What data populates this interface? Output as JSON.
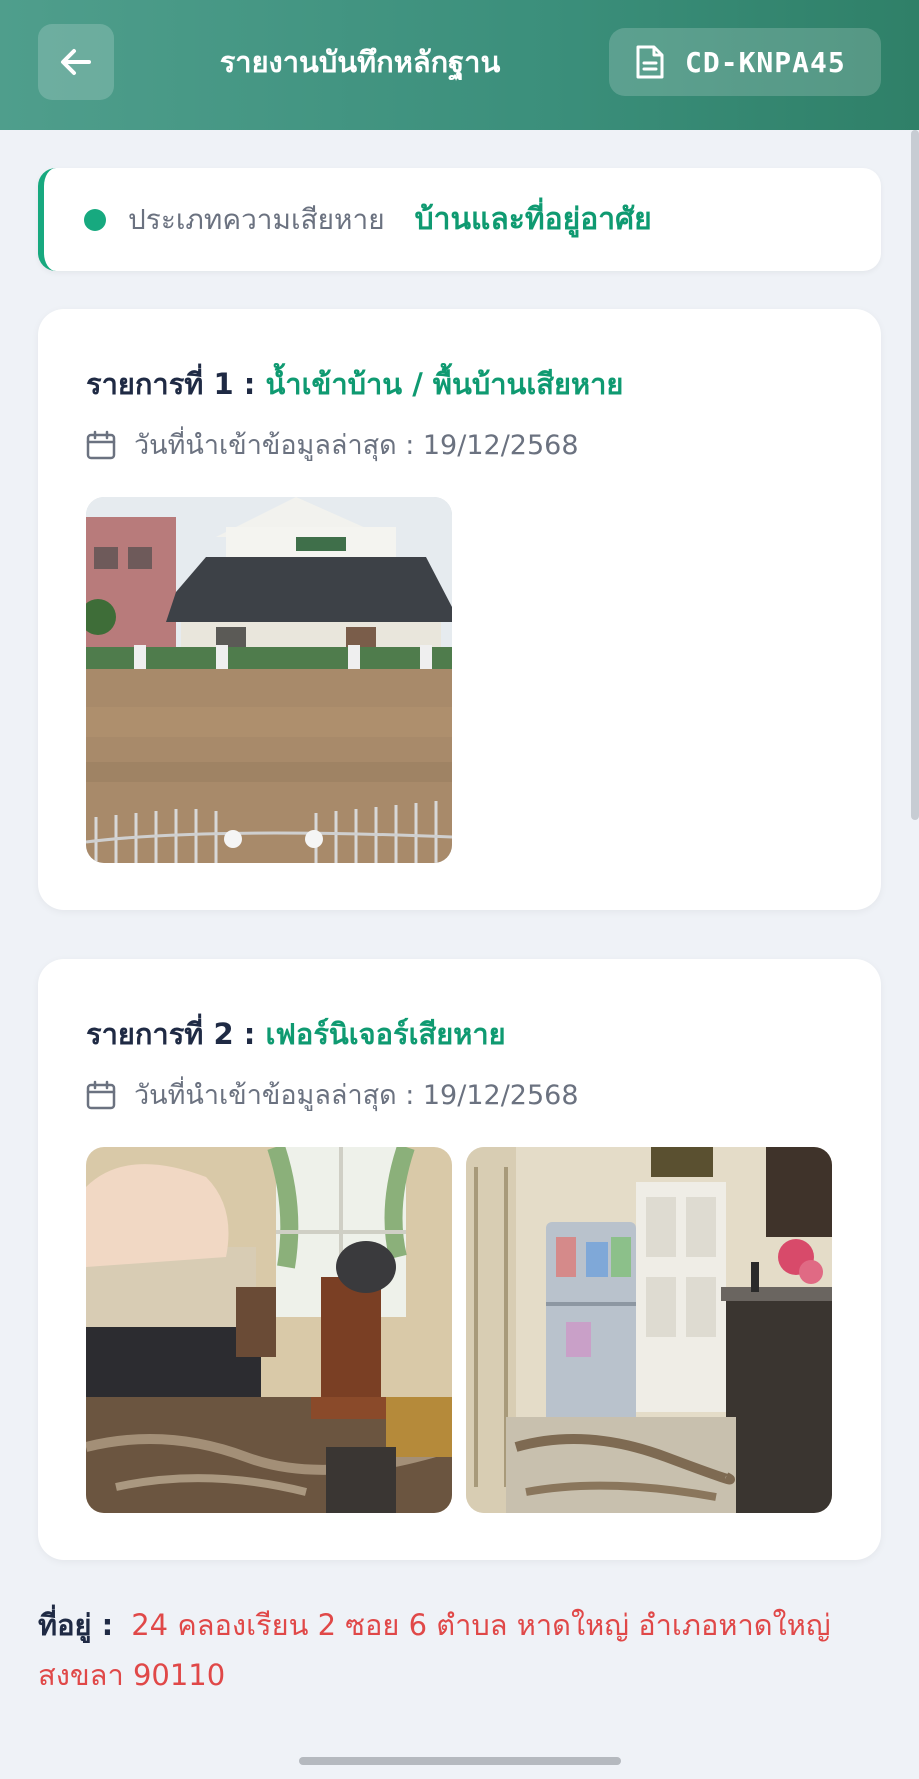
{
  "header": {
    "title": "รายงานบันทึกหลักฐาน",
    "code": "CD-KNPA45",
    "back_icon": "arrow-left-icon",
    "doc_icon": "document-icon"
  },
  "damage_type": {
    "label": "ประเภทความเสียหาย",
    "value": "บ้านและที่อยู่อาศัย"
  },
  "items": [
    {
      "prefix": "รายการที่ 1 :",
      "name": "น้ำเข้าบ้าน / พื้นบ้านเสียหาย",
      "date_text": "วันที่นำเข้าข้อมูลล่าสุด : 19/12/2568"
    },
    {
      "prefix": "รายการที่ 2 :",
      "name": "เฟอร์นิเจอร์เสียหาย",
      "date_text": "วันที่นำเข้าข้อมูลล่าสุด : 19/12/2568"
    }
  ],
  "address": {
    "label": "ที่อยู่ :",
    "value": "24 คลองเรียน 2 ซอย 6 ตำบล หาดใหญ่ อำเภอหาดใหญ่ สงขลา 90110"
  },
  "colors": {
    "accent": "#0f9a71",
    "header": "#3b8f7b",
    "address": "#e04848"
  }
}
